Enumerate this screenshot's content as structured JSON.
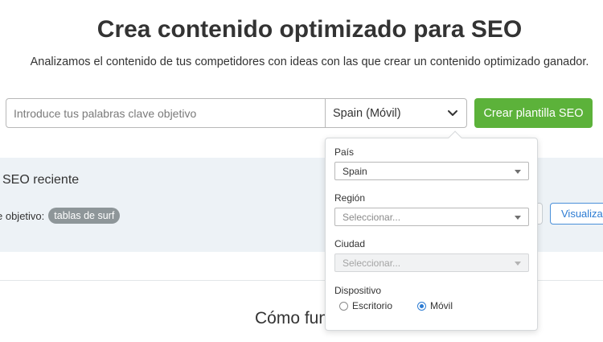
{
  "header": {
    "title": "Crea contenido optimizado para SEO",
    "subtitle": "Analizamos el contenido de tus competidores con ideas con las que crear un contenido optimizado ganador."
  },
  "search": {
    "placeholder": "Introduce tus palabras clave objetivo",
    "value": "",
    "country_selected": "Spain (Móvil)",
    "submit_label": "Crear plantilla SEO"
  },
  "recent": {
    "title": "SEO reciente",
    "keyword_prefix": "e objetivo:",
    "keyword_tag": "tablas de surf",
    "view_label": "Visualizar"
  },
  "how": {
    "title": "Cómo fun"
  },
  "location_panel": {
    "country": {
      "label": "País",
      "value": "Spain"
    },
    "region": {
      "label": "Región",
      "placeholder": "Seleccionar..."
    },
    "city": {
      "label": "Ciudad",
      "placeholder": "Seleccionar..."
    },
    "device": {
      "label": "Dispositivo",
      "options": [
        {
          "label": "Escritorio",
          "checked": false
        },
        {
          "label": "Móvil",
          "checked": true
        }
      ]
    }
  },
  "icons": {
    "country_chevron": "chevron-down-icon",
    "select_arrow": "triangle-down-icon"
  },
  "colors": {
    "primary_button": "#5cb23a",
    "link_blue": "#2b7bd3",
    "tag_bg": "#8e9699",
    "section_bg": "#edf2f6"
  }
}
